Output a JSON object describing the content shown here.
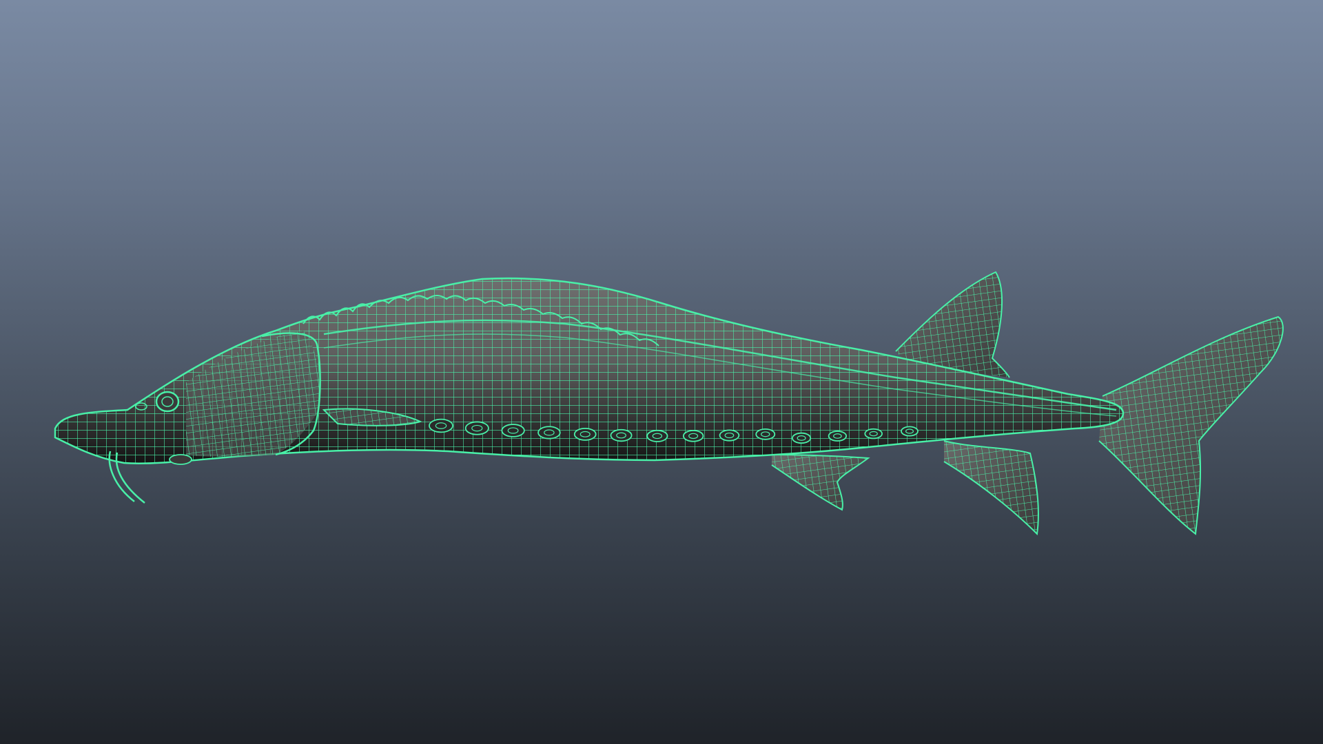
{
  "viewport": {
    "mode": "wireframe-on-shaded",
    "background_top": "#7a8aa3",
    "background_bottom": "#1f2329"
  },
  "model": {
    "subject": "sturgeon",
    "wire_color": "#49f0a8",
    "shade_color": "#5e5e5e",
    "lateral_scute_count": 14
  }
}
